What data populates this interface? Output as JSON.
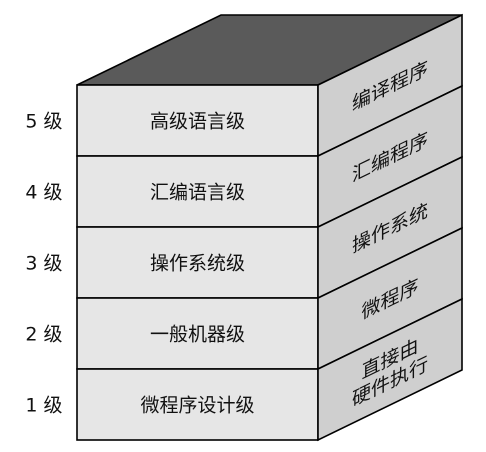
{
  "diagram": {
    "levels": [
      {
        "number": "5 级",
        "name": "高级语言级"
      },
      {
        "number": "4 级",
        "name": "汇编语言级"
      },
      {
        "number": "3 级",
        "name": "操作系统级"
      },
      {
        "number": "2 级",
        "name": "一般机器级"
      },
      {
        "number": "1 级",
        "name": "微程序设计级"
      }
    ],
    "side_labels": [
      {
        "lines": [
          "编译程序"
        ]
      },
      {
        "lines": [
          "汇编程序"
        ]
      },
      {
        "lines": [
          "操作系统"
        ]
      },
      {
        "lines": [
          "微程序"
        ]
      },
      {
        "lines": [
          "直接由",
          "硬件执行"
        ]
      }
    ]
  },
  "colors": {
    "front": "#e6e6e6",
    "side": "#cfcfcf",
    "top": "#5a5a5a",
    "outline": "#000000",
    "text": "#111111"
  }
}
